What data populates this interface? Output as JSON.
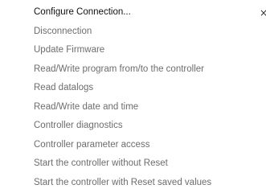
{
  "menu": {
    "close_glyph": "×",
    "items": [
      {
        "label": "Configure Connection...",
        "enabled": true
      },
      {
        "label": "Disconnection",
        "enabled": false
      },
      {
        "label": "Update Firmware",
        "enabled": false
      },
      {
        "label": "Read/Write program from/to the controller",
        "enabled": false
      },
      {
        "label": "Read datalogs",
        "enabled": false
      },
      {
        "label": "Read/Write date and time",
        "enabled": false
      },
      {
        "label": "Controller diagnostics",
        "enabled": false
      },
      {
        "label": "Controller parameter access",
        "enabled": false
      },
      {
        "label": "Start the controller without Reset",
        "enabled": false
      },
      {
        "label": "Start the controller with Reset saved values",
        "enabled": false
      }
    ]
  }
}
